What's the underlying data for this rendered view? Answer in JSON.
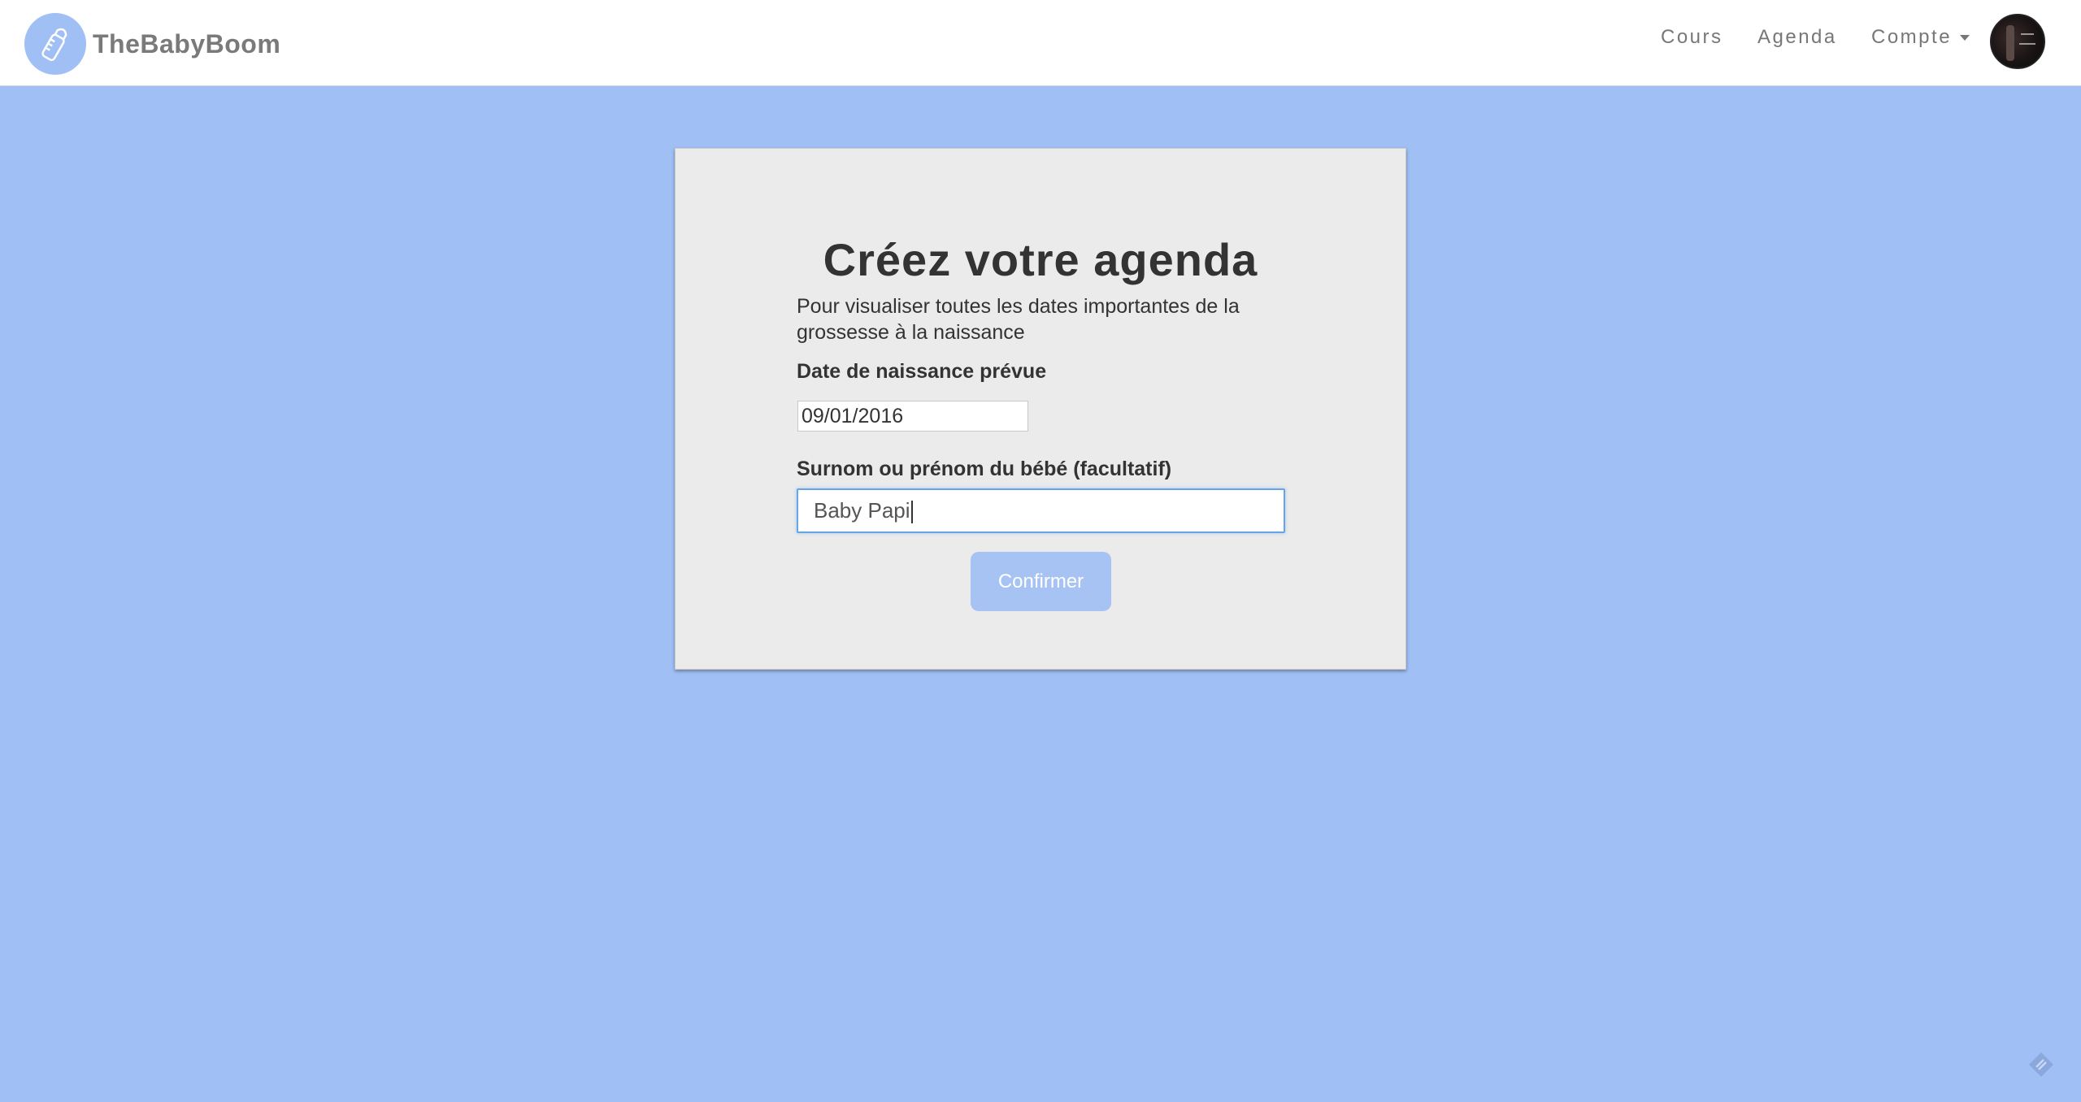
{
  "brand": {
    "name": "TheBabyBoom",
    "logo_icon": "baby-bottle-icon"
  },
  "nav": {
    "items": [
      {
        "label": "Cours"
      },
      {
        "label": "Agenda"
      },
      {
        "label": "Compte"
      }
    ]
  },
  "form": {
    "title": "Créez votre agenda",
    "subtitle": "Pour visualiser toutes les dates importantes de la grossesse à la naissance",
    "date_label": "Date de naissance prévue",
    "date_value": "09/01/2016",
    "name_label": "Surnom ou prénom du bébé (facultatif)",
    "name_value": "Baby Papi",
    "confirm_label": "Confirmer"
  },
  "colors": {
    "background": "#a0bff4",
    "card": "#ebebeb",
    "button": "#a7c3f3",
    "input_focus_border": "#66a6e8"
  }
}
